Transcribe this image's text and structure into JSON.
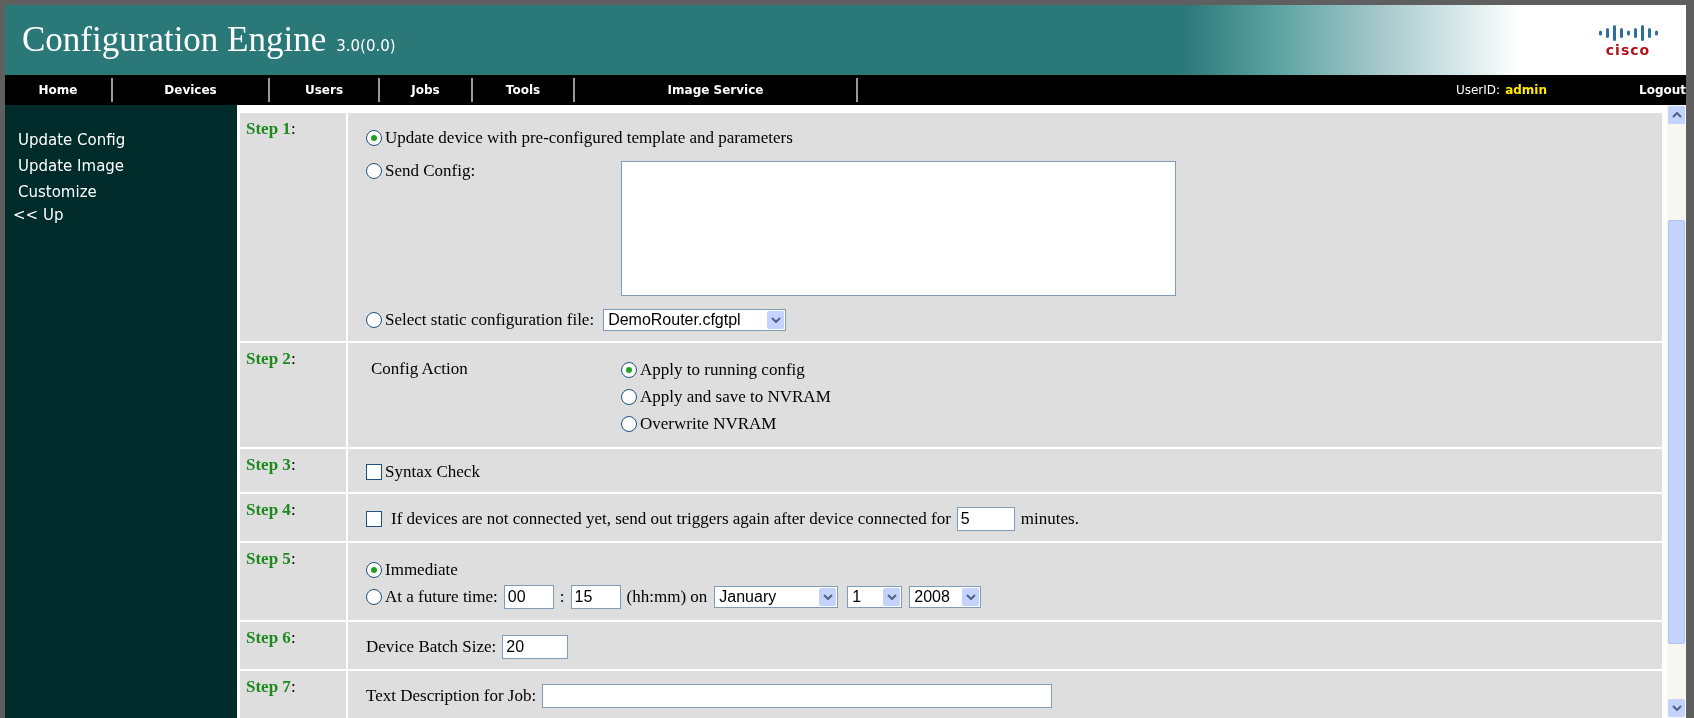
{
  "header": {
    "title": "Configuration Engine",
    "version": "3.0(0.0)",
    "logo_text": "cisco"
  },
  "nav": {
    "items": [
      {
        "label": "Home",
        "selected": false
      },
      {
        "label": "Devices",
        "selected": false
      },
      {
        "label": "Users",
        "selected": false
      },
      {
        "label": "Jobs",
        "selected": false
      },
      {
        "label": "Tools",
        "selected": false
      },
      {
        "label": "Image Service",
        "selected": false
      }
    ],
    "user_label": "UserID:",
    "user": "admin",
    "logout": "Logout"
  },
  "sidebar": {
    "items": [
      "Update Config",
      "Update Image",
      "Customize"
    ],
    "up_link": "<< Up"
  },
  "steps": [
    {
      "label": "**Step 1**:",
      "kind": "source",
      "options": [
        {
          "kind": "plain",
          "label": "Update device with pre-configured template and parameters",
          "selected": true
        },
        {
          "kind": "textarea",
          "label": "Send Config:",
          "selected": false
        },
        {
          "kind": "select",
          "label": "Select static configuration file:",
          "value": "DemoRouter.cfgtpl",
          "selected": false
        }
      ]
    },
    {
      "label": "**Step 2**:",
      "kind": "radio_group",
      "title": "Config Action",
      "options": [
        {
          "label": "Apply to running config",
          "selected": true
        },
        {
          "label": "Apply and save to NVRAM",
          "selected": false
        },
        {
          "label": "Overwrite NVRAM",
          "selected": false
        }
      ]
    },
    {
      "label": "**Step 3**:",
      "kind": "checkbox",
      "text": "Syntax Check",
      "checked": false
    },
    {
      "label": "**Step 4**:",
      "kind": "checkbox_input",
      "text": "If devices are not connected yet, send out triggers again after device connected for",
      "value": "5",
      "suffix": "minutes.",
      "checked": false
    },
    {
      "label": "**Step 5**:",
      "kind": "schedule",
      "immediate": {
        "label": "Immediate",
        "selected": true
      },
      "future": {
        "label": "At a future time:",
        "selected": false,
        "hour": "00",
        "separator": ":",
        "minute": "15",
        "format": "(hh:mm) on",
        "month": "January",
        "day": "1",
        "year": "2008"
      }
    },
    {
      "label": "**Step 6**:",
      "kind": "input",
      "text": "Device Batch Size:",
      "value": "20",
      "wide": false
    },
    {
      "label": "**Step 7**:",
      "kind": "input",
      "text": "Text Description for Job:",
      "wide": true
    }
  ]
}
